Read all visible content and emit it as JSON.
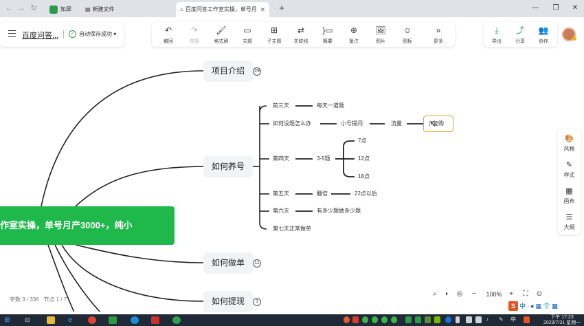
{
  "browser": {
    "tabs": [
      {
        "label": "知犀",
        "active": false
      },
      {
        "label": "新建文件",
        "active": false
      },
      {
        "label": "百度问答工作室实操，单号月",
        "active": true
      }
    ],
    "new_tab": "+"
  },
  "header": {
    "doc_title": "百度问答...",
    "save_status": "自动保存成功"
  },
  "toolbar": {
    "items": [
      {
        "label": "撤回",
        "icon": "undo-icon",
        "glyph": "↶"
      },
      {
        "label": "恢复",
        "icon": "redo-icon",
        "glyph": "↷"
      },
      {
        "label": "格式刷",
        "icon": "format-brush-icon",
        "glyph": "🖌"
      },
      {
        "label": "主题",
        "icon": "topic-icon",
        "glyph": "▭"
      },
      {
        "label": "子主题",
        "icon": "subtopic-icon",
        "glyph": "⊞"
      },
      {
        "label": "关联线",
        "icon": "relation-line-icon",
        "glyph": "⇄"
      },
      {
        "label": "概要",
        "icon": "summary-icon",
        "glyph": "}▭"
      },
      {
        "label": "备注",
        "icon": "note-icon",
        "glyph": "⊕"
      },
      {
        "label": "图片",
        "icon": "image-icon",
        "glyph": "🖼"
      },
      {
        "label": "图标",
        "icon": "emoji-icon",
        "glyph": "☺"
      },
      {
        "label": "更多",
        "icon": "more-icon",
        "glyph": "»"
      }
    ],
    "share": [
      {
        "label": "导出",
        "icon": "export-icon",
        "glyph": "⤓"
      },
      {
        "label": "分享",
        "icon": "share-icon",
        "glyph": "⤴"
      },
      {
        "label": "协作",
        "icon": "collaborate-icon",
        "glyph": "👥"
      }
    ]
  },
  "mindmap": {
    "central": "作室实操，单号月产3000+，纯小",
    "topics": [
      {
        "label": "项目介绍",
        "count": "29"
      },
      {
        "label": "如何养号",
        "count": ""
      },
      {
        "label": "如何做单",
        "count": "11"
      },
      {
        "label": "如何提现",
        "count": "3"
      }
    ],
    "branches": {
      "day1_3": {
        "label": "前三天",
        "child": "每天一道题"
      },
      "no_topic": {
        "label": "如何没题怎么办",
        "child1": "小号提问",
        "child2": "流量",
        "child3": "复购"
      },
      "day4": {
        "label": "第四天",
        "child": "3-5题",
        "times": [
          "7点",
          "12点",
          "18点"
        ]
      },
      "day5": {
        "label": "第五天",
        "child1": "翻倍",
        "child2": "22点以后"
      },
      "day6": {
        "label": "第六天",
        "child": "有多少题做多少题"
      },
      "day7": {
        "label": "第七天正常做单"
      }
    }
  },
  "sidepanel": [
    {
      "label": "风格",
      "icon": "palette-icon",
      "glyph": "🎨"
    },
    {
      "label": "样式",
      "icon": "style-icon",
      "glyph": "✎"
    },
    {
      "label": "画布",
      "icon": "canvas-icon",
      "glyph": "▦"
    },
    {
      "label": "大纲",
      "icon": "outline-icon",
      "glyph": "☰"
    }
  ],
  "status": {
    "word_count": "字数 3 / 336",
    "node_count": "节点 1 / 7"
  },
  "zoom": {
    "level": "100%"
  },
  "taskbar": {
    "clock_time": "下午 17:23",
    "clock_date": "2023/7/31 星期一"
  },
  "colors": {
    "central": "#1fb84a",
    "accent": "#2c9a47",
    "selected_border": "#e6a524",
    "topic_bg": "#f2f3f5"
  }
}
